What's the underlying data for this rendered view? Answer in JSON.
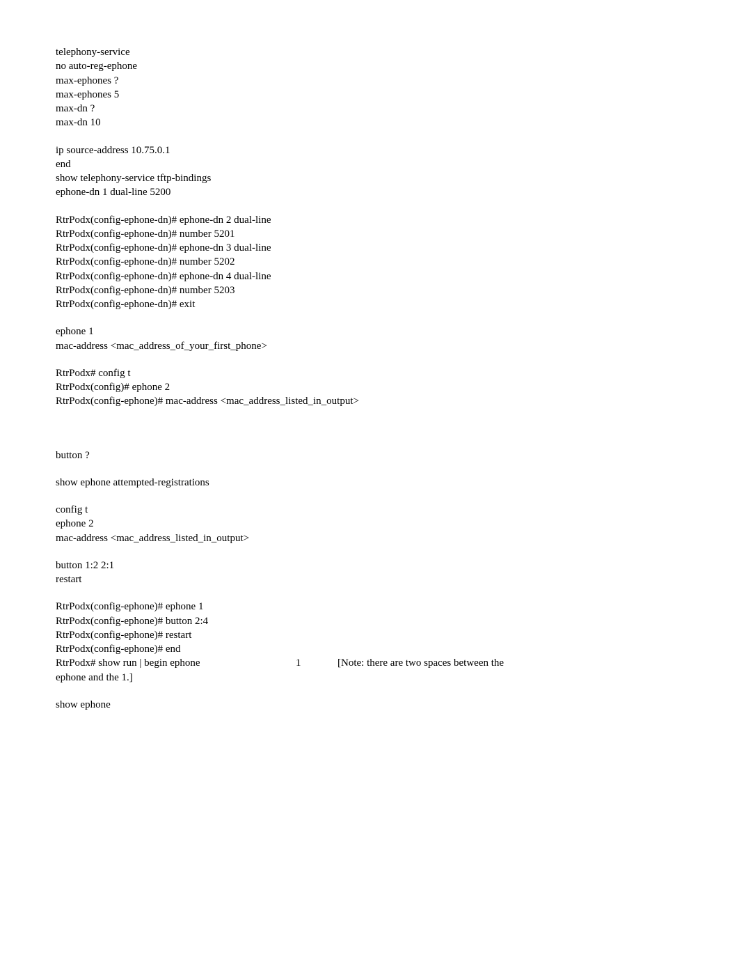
{
  "lines": [
    "telephony-service",
    "no auto-reg-ephone",
    "max-ephones ?",
    "max-ephones 5",
    "max-dn ?",
    "max-dn 10",
    "",
    "ip source-address 10.75.0.1",
    "end",
    "show telephony-service tftp-bindings",
    "ephone-dn 1 dual-line 5200",
    "",
    "RtrPodx(config-ephone-dn)# ephone-dn 2 dual-line",
    "RtrPodx(config-ephone-dn)# number 5201",
    "RtrPodx(config-ephone-dn)# ephone-dn 3 dual-line",
    "RtrPodx(config-ephone-dn)# number 5202",
    "RtrPodx(config-ephone-dn)# ephone-dn 4 dual-line",
    "RtrPodx(config-ephone-dn)# number 5203",
    "RtrPodx(config-ephone-dn)# exit",
    "",
    "ephone 1",
    "mac-address <mac_address_of_your_first_phone>",
    "",
    "RtrPodx# config t",
    "RtrPodx(config)# ephone 2",
    "RtrPodx(config-ephone)# mac-address <mac_address_listed_in_output>",
    "",
    "",
    "",
    "button ?",
    "",
    "show ephone attempted-registrations",
    "",
    "config t",
    "ephone 2",
    "mac-address <mac_address_listed_in_output>",
    "",
    "button 1:2 2:1",
    "restart",
    "",
    "RtrPodx(config-ephone)# ephone 1",
    "RtrPodx(config-ephone)# button 2:4",
    "RtrPodx(config-ephone)# restart",
    "RtrPodx(config-ephone)# end"
  ],
  "noteRow": {
    "col1": "RtrPodx# show run | begin ephone",
    "col2": "1",
    "col3": "[Note: there are two spaces between the"
  },
  "tailLines": [
    "ephone and the 1.]",
    "",
    "show ephone"
  ]
}
